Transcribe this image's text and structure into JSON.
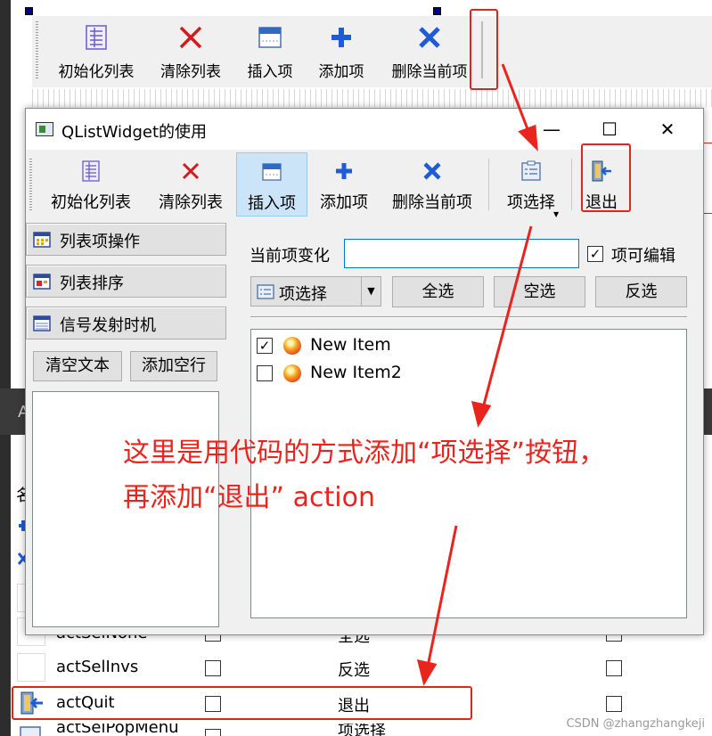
{
  "background_designer": {
    "toolbar": [
      {
        "label": "初始化列表",
        "icon": "list-init-icon"
      },
      {
        "label": "清除列表",
        "icon": "red-x-icon"
      },
      {
        "label": "插入项",
        "icon": "insert-item-icon"
      },
      {
        "label": "添加项",
        "icon": "blue-plus-icon"
      },
      {
        "label": "删除当前项",
        "icon": "blue-x-icon"
      }
    ],
    "dark_strip_letter": "A",
    "partial_char": "名",
    "rows": [
      {
        "name": "actSelNone",
        "text": "全选"
      },
      {
        "name": "actSelInvs",
        "text": "反选"
      },
      {
        "name": "actQuit",
        "text": "退出"
      },
      {
        "name": "actSelPopMenu",
        "text": "项选择"
      }
    ]
  },
  "window": {
    "title": "QListWidget的使用",
    "controls": {
      "minimize": "—",
      "maximize": "☐",
      "close": "✕"
    },
    "toolbar": [
      {
        "label": "初始化列表",
        "icon": "list-init-icon"
      },
      {
        "label": "清除列表",
        "icon": "red-x-icon"
      },
      {
        "label": "插入项",
        "icon": "insert-item-icon"
      },
      {
        "label": "添加项",
        "icon": "blue-plus-icon"
      },
      {
        "label": "删除当前项",
        "icon": "blue-x-icon"
      },
      {
        "label": "项选择",
        "icon": "item-select-icon"
      },
      {
        "label": "退出",
        "icon": "exit-door-icon"
      }
    ],
    "left_panel": {
      "toolbox_pages": [
        "列表项操作",
        "列表排序",
        "信号发射时机"
      ],
      "clear_text_label": "清空文本",
      "add_blank_line_label": "添加空行",
      "plain_text": ""
    },
    "right_panel": {
      "current_item_label": "当前项变化",
      "current_item_value": "",
      "editable_label": "项可编辑",
      "editable_checked": true,
      "combo_label": "项选择",
      "select_all_label": "全选",
      "select_none_label": "空选",
      "select_invert_label": "反选",
      "items": [
        {
          "text": "New Item",
          "checked": true
        },
        {
          "text": "New Item2",
          "checked": false
        }
      ]
    }
  },
  "annotation": {
    "line1": "这里是用代码的方式添加“项选择”按钮，",
    "line2": "再添加“退出” action",
    "color": "#e8241d"
  },
  "watermark": "CSDN @zhangzhangkeji"
}
